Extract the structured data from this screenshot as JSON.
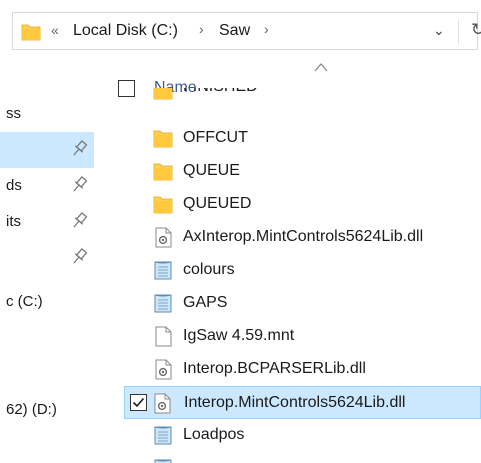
{
  "address": {
    "overflow": "«",
    "crumbs": [
      "Local Disk (C:)",
      "Saw"
    ],
    "separator": "›",
    "dropdown": "⌄",
    "refresh": "↻"
  },
  "sidebar": {
    "items": [
      {
        "label": "ss"
      },
      {
        "label": ""
      },
      {
        "label": "ds"
      },
      {
        "label": "its"
      },
      {
        "label": ""
      },
      {
        "label": "c (C:)"
      },
      {
        "label": "62) (D:)"
      }
    ]
  },
  "header": {
    "name_label": "Name"
  },
  "files": [
    {
      "name": "FINISHED",
      "type": "folder"
    },
    {
      "name": "OFFCUT",
      "type": "folder"
    },
    {
      "name": "QUEUE",
      "type": "folder"
    },
    {
      "name": "QUEUED",
      "type": "folder"
    },
    {
      "name": "AxInterop.MintControls5624Lib.dll",
      "type": "dll"
    },
    {
      "name": "colours",
      "type": "text"
    },
    {
      "name": "GAPS",
      "type": "text"
    },
    {
      "name": "IgSaw 4.59.mnt",
      "type": "file"
    },
    {
      "name": "Interop.BCPARSERLib.dll",
      "type": "dll"
    },
    {
      "name": "Interop.MintControls5624Lib.dll",
      "type": "dll",
      "selected": true,
      "checked": true
    },
    {
      "name": "Loadpos",
      "type": "text"
    }
  ],
  "colors": {
    "folder": "#ffd15c",
    "selection": "#cce8ff",
    "header_text": "#3d5a99"
  }
}
